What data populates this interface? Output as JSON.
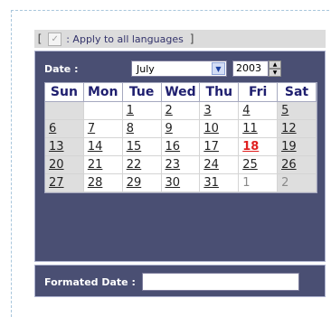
{
  "apply": {
    "bracket_open": "[",
    "bracket_close": "]",
    "check_glyph": "✓",
    "label": ": Apply to all languages"
  },
  "calendar": {
    "date_label": "Date :",
    "month": "July",
    "year": "2003",
    "days": [
      "Sun",
      "Mon",
      "Tue",
      "Wed",
      "Thu",
      "Fri",
      "Sat"
    ],
    "weeks": [
      [
        "",
        "",
        "1",
        "2",
        "3",
        "4",
        "5"
      ],
      [
        "6",
        "7",
        "8",
        "9",
        "10",
        "11",
        "12"
      ],
      [
        "13",
        "14",
        "15",
        "16",
        "17",
        "18",
        "19"
      ],
      [
        "20",
        "21",
        "22",
        "23",
        "24",
        "25",
        "26"
      ],
      [
        "27",
        "28",
        "29",
        "30",
        "31",
        "1",
        "2"
      ]
    ],
    "today": "18"
  },
  "formatted": {
    "label": "Formated Date :",
    "value": ""
  },
  "colors": {
    "panel": "#4a4f73",
    "weekend": "#dedede",
    "today": "#e02020",
    "header_text": "#1f1f6f"
  }
}
